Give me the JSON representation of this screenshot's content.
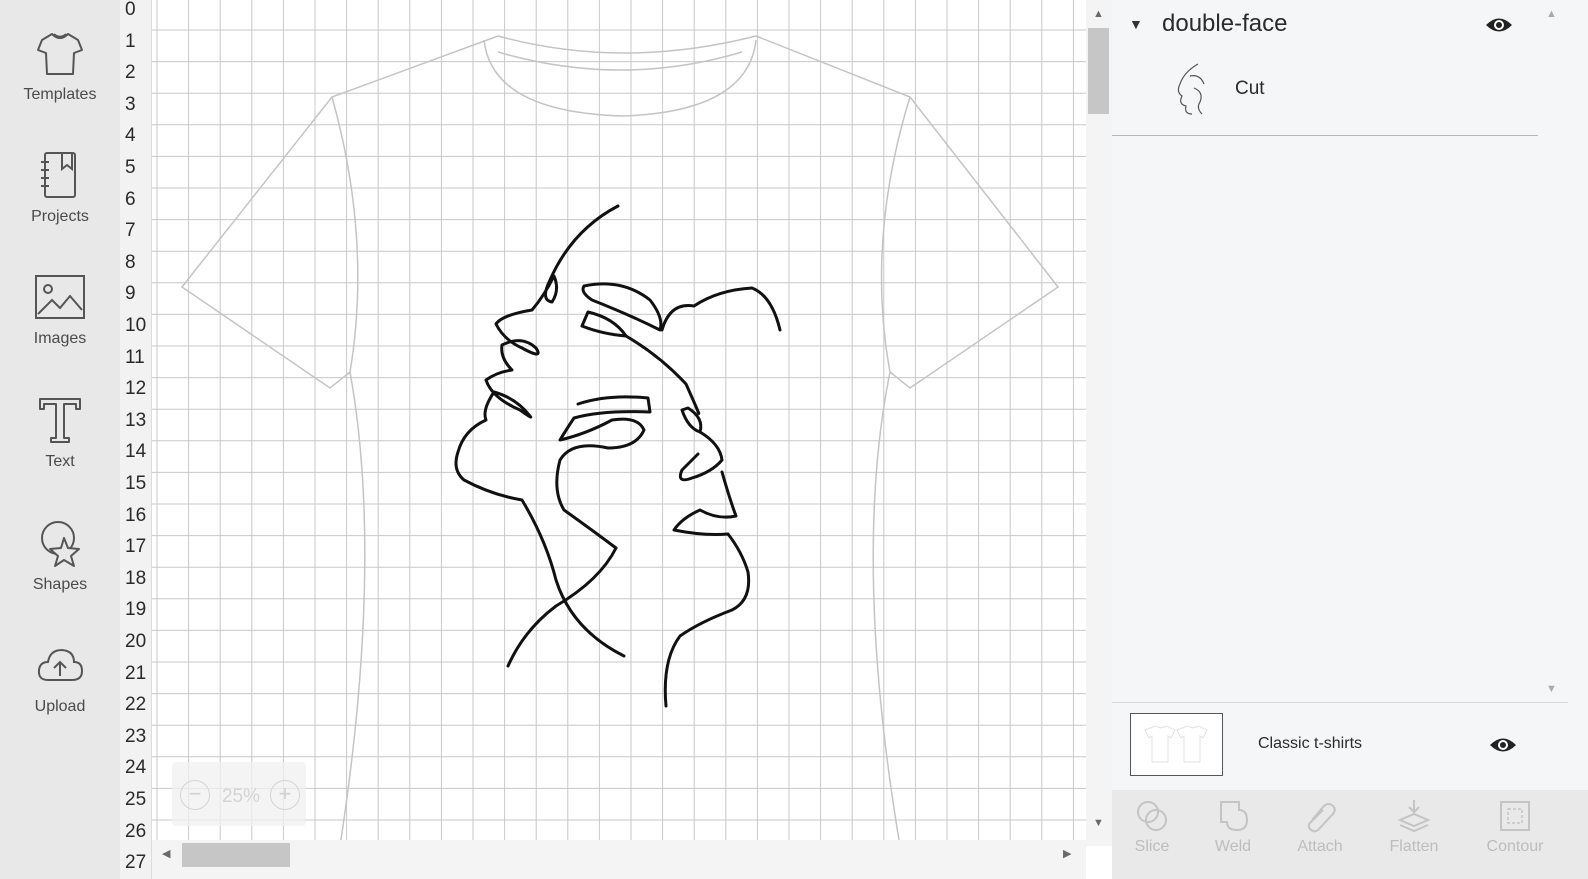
{
  "sidebar": {
    "items": [
      {
        "label": "Templates",
        "icon": "tshirt-icon"
      },
      {
        "label": "Projects",
        "icon": "notebook-icon"
      },
      {
        "label": "Images",
        "icon": "image-icon"
      },
      {
        "label": "Text",
        "icon": "text-t-icon"
      },
      {
        "label": "Shapes",
        "icon": "shapes-icon"
      },
      {
        "label": "Upload",
        "icon": "cloud-upload-icon"
      }
    ]
  },
  "ruler": {
    "marks": [
      "0",
      "1",
      "2",
      "3",
      "4",
      "5",
      "6",
      "7",
      "8",
      "9",
      "10",
      "11",
      "12",
      "13",
      "14",
      "15",
      "16",
      "17",
      "18",
      "19",
      "20",
      "21",
      "22",
      "23",
      "24",
      "25",
      "26",
      "27"
    ]
  },
  "zoom": {
    "minus": "−",
    "value": "25%",
    "plus": "+"
  },
  "layers": {
    "group_name": "double-face",
    "group_icon": "eye-icon",
    "layer_name": "Cut"
  },
  "canvas_layer": {
    "label": "Classic t-shirts",
    "icon": "eye-icon"
  },
  "toolbar": {
    "tools": [
      {
        "label": "Slice",
        "icon": "slice-icon"
      },
      {
        "label": "Weld",
        "icon": "weld-icon"
      },
      {
        "label": "Attach",
        "icon": "paperclip-icon"
      },
      {
        "label": "Flatten",
        "icon": "flatten-icon"
      },
      {
        "label": "Contour",
        "icon": "contour-icon"
      }
    ]
  },
  "colors": {
    "sidebar_bg": "#e8e8e8",
    "panel_bg": "#f5f6f8",
    "grid_line": "#c8c8c8",
    "artwork": "#111111",
    "disabled_text": "#bdbdbd"
  }
}
